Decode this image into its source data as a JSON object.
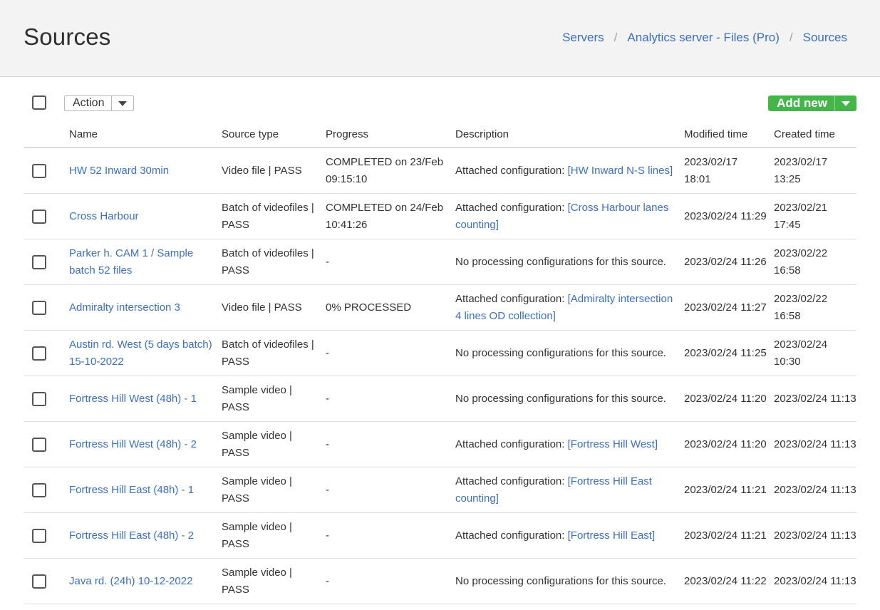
{
  "header": {
    "title": "Sources",
    "breadcrumb": [
      "Servers",
      "Analytics server - Files (Pro)",
      "Sources"
    ]
  },
  "toolbar": {
    "action_label": "Action",
    "add_new_label": "Add new"
  },
  "table": {
    "columns": [
      "Name",
      "Source type",
      "Progress",
      "Description",
      "Modified time",
      "Created time"
    ],
    "rows": [
      {
        "name": "HW 52 Inward 30min",
        "type": "Video file | PASS",
        "progress": "COMPLETED on 23/Feb 09:15:10",
        "desc_prefix": "Attached configuration: ",
        "desc_link": "[HW Inward N-S lines]",
        "modified": "2023/02/17 18:01",
        "created": "2023/02/17 13:25"
      },
      {
        "name": "Cross Harbour",
        "type": "Batch of videofiles | PASS",
        "progress": "COMPLETED on 24/Feb 10:41:26",
        "desc_prefix": "Attached configuration: ",
        "desc_link": "[Cross Harbour lanes counting]",
        "modified": "2023/02/24 11:29",
        "created": "2023/02/21 17:45"
      },
      {
        "name": "Parker h. CAM 1 / Sample batch 52 files",
        "type": "Batch of videofiles | PASS",
        "progress": "-",
        "desc_prefix": "No processing configurations for this source.",
        "desc_link": "",
        "modified": "2023/02/24 11:26",
        "created": "2023/02/22 16:58"
      },
      {
        "name": "Admiralty intersection 3",
        "type": "Video file | PASS",
        "progress": "0% PROCESSED",
        "desc_prefix": "Attached configuration: ",
        "desc_link": "[Admiralty intersection 4 lines OD collection]",
        "modified": "2023/02/24 11:27",
        "created": "2023/02/22 16:58"
      },
      {
        "name": "Austin rd. West (5 days batch) 15-10-2022",
        "type": "Batch of videofiles | PASS",
        "progress": "-",
        "desc_prefix": "No processing configurations for this source.",
        "desc_link": "",
        "modified": "2023/02/24 11:25",
        "created": "2023/02/24 10:30"
      },
      {
        "name": "Fortress Hill West (48h) - 1",
        "type": "Sample video | PASS",
        "progress": "-",
        "desc_prefix": "No processing configurations for this source.",
        "desc_link": "",
        "modified": "2023/02/24 11:20",
        "created": "2023/02/24 11:13"
      },
      {
        "name": "Fortress Hill West (48h) - 2",
        "type": "Sample video | PASS",
        "progress": "-",
        "desc_prefix": "Attached configuration: ",
        "desc_link": "[Fortress Hill West]",
        "modified": "2023/02/24 11:20",
        "created": "2023/02/24 11:13"
      },
      {
        "name": "Fortress Hill East (48h) - 1",
        "type": "Sample video | PASS",
        "progress": "-",
        "desc_prefix": "Attached configuration: ",
        "desc_link": "[Fortress Hill East counting]",
        "modified": "2023/02/24 11:21",
        "created": "2023/02/24 11:13"
      },
      {
        "name": "Fortress Hill East (48h) - 2",
        "type": "Sample video | PASS",
        "progress": "-",
        "desc_prefix": "Attached configuration: ",
        "desc_link": "[Fortress Hill East]",
        "modified": "2023/02/24 11:21",
        "created": "2023/02/24 11:13"
      },
      {
        "name": "Java rd. (24h) 10-12-2022",
        "type": "Sample video | PASS",
        "progress": "-",
        "desc_prefix": "No processing configurations for this source.",
        "desc_link": "",
        "modified": "2023/02/24 11:22",
        "created": "2023/02/24 11:13"
      }
    ]
  }
}
